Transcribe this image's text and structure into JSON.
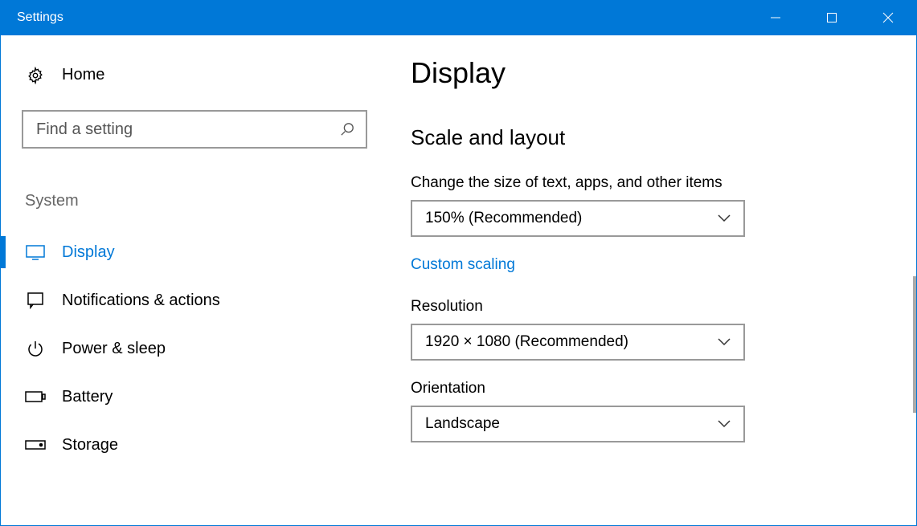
{
  "window": {
    "title": "Settings"
  },
  "sidebar": {
    "home_label": "Home",
    "search_placeholder": "Find a setting",
    "category_label": "System",
    "items": [
      {
        "label": "Display",
        "icon": "display-icon",
        "active": true
      },
      {
        "label": "Notifications & actions",
        "icon": "notifications-icon",
        "active": false
      },
      {
        "label": "Power & sleep",
        "icon": "power-icon",
        "active": false
      },
      {
        "label": "Battery",
        "icon": "battery-icon",
        "active": false
      },
      {
        "label": "Storage",
        "icon": "storage-icon",
        "active": false
      }
    ]
  },
  "content": {
    "page_title": "Display",
    "section_title": "Scale and layout",
    "scaling": {
      "label": "Change the size of text, apps, and other items",
      "value": "150% (Recommended)",
      "link": "Custom scaling"
    },
    "resolution": {
      "label": "Resolution",
      "value": "1920 × 1080 (Recommended)"
    },
    "orientation": {
      "label": "Orientation",
      "value": "Landscape"
    }
  }
}
